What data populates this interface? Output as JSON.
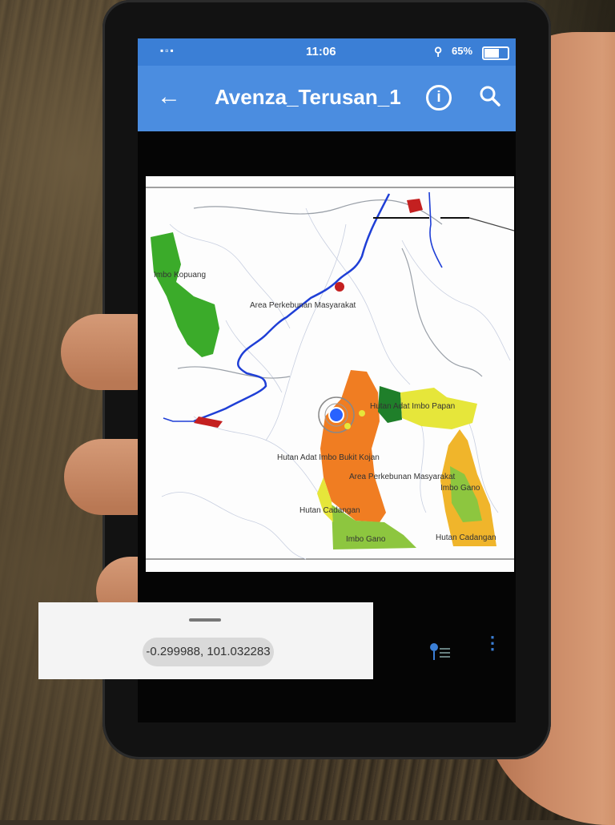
{
  "status_bar": {
    "time": "11:06",
    "battery": "65%"
  },
  "app_bar": {
    "title": "Avenza_Terusan_1"
  },
  "map": {
    "labels": {
      "imbo_kopuang": "Imbo Kopuang",
      "area_perkebunan_1": "Area Perkebunan Masyarakat",
      "hutan_adat_imbo_papan": "Hutan Adat Imbo Papan",
      "hutan_adat_bukit_kojan": "Hutan Adat Imbo Bukit Kojan",
      "area_perkebunan_2": "Area Perkebunan Masyarakat",
      "imbo_gano_1": "Imbo Gano",
      "hutan_cadangan_1": "Hutan Cadangan",
      "imbo_gano_2": "Imbo Gano",
      "hutan_cadangan_2": "Hutan Cadangan"
    },
    "colors": {
      "orange": "#f07d22",
      "green": "#3bab2a",
      "light_green": "#8dc63f",
      "yellow": "#e6e63a",
      "gold": "#f0b52b",
      "dark_green": "#1f7f2a",
      "river": "#1f3fd6",
      "settlement": "#c42020"
    }
  },
  "bottom_bar": {
    "coordinates": "-0.299988, 101.032283"
  }
}
